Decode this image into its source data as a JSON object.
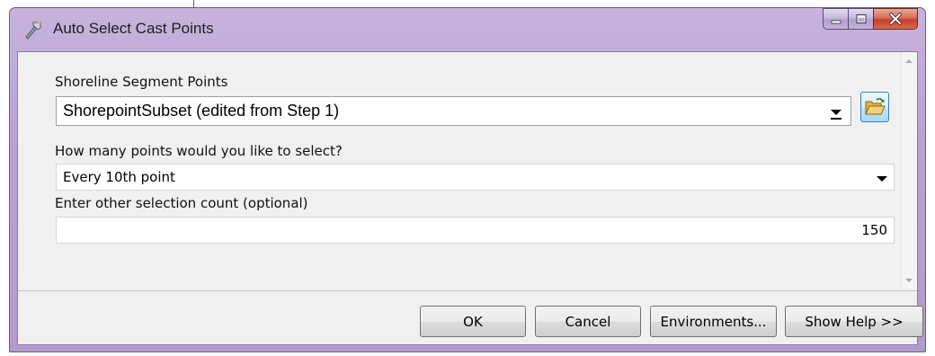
{
  "window": {
    "title": "Auto Select Cast Points",
    "buttons": {
      "minimize": "minimize-icon",
      "maximize": "maximize-icon",
      "close": "close-icon"
    }
  },
  "form": {
    "shoreline": {
      "label": "Shoreline Segment Points",
      "value": "ShorepointSubset (edited from Step 1)"
    },
    "points": {
      "label": "How many points would you like to select?",
      "value": "Every 10th point"
    },
    "count": {
      "label": "Enter other selection count (optional)",
      "value": "150"
    }
  },
  "actions": {
    "ok": "OK",
    "cancel": "Cancel",
    "environments": "Environments...",
    "show_help": "Show Help >>"
  },
  "colors": {
    "titlebar": "#b9a1d3",
    "close_button": "#c2422a",
    "browse_button": "#bee6fd"
  }
}
